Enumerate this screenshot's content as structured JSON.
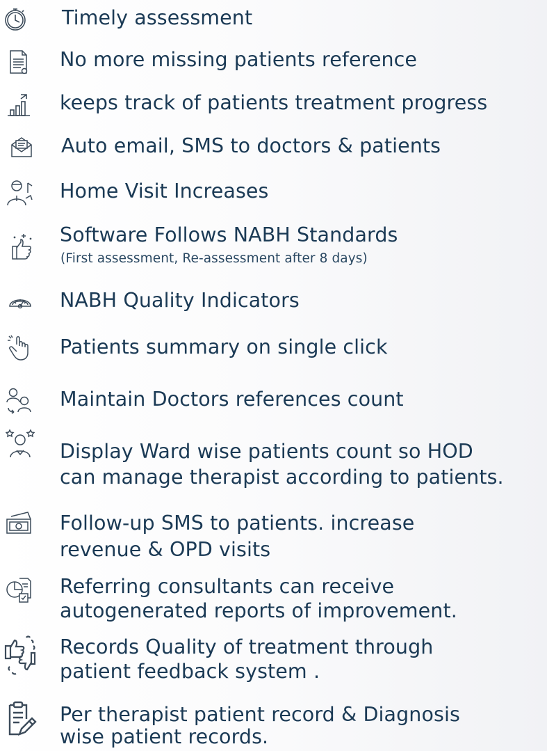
{
  "features": [
    {
      "icon": "stopwatch-icon",
      "line1": "Timely assessment",
      "line2": "",
      "sub": ""
    },
    {
      "icon": "document-icon",
      "line1": "No more missing patients reference",
      "line2": "",
      "sub": ""
    },
    {
      "icon": "bar-chart-growth-icon",
      "line1": "keeps track of patients treatment progress",
      "line2": "",
      "sub": ""
    },
    {
      "icon": "envelope-icon",
      "line1": "Auto email, SMS to doctors & patients",
      "line2": "",
      "sub": ""
    },
    {
      "icon": "home-visit-doctor-icon",
      "line1": "Home Visit Increases",
      "line2": "",
      "sub": ""
    },
    {
      "icon": "thumbs-up-sparkle-icon",
      "line1": "Software Follows NABH Standards",
      "line2": "",
      "sub": "(First assessment, Re-assessment after 8 days)"
    },
    {
      "icon": "gauge-icon",
      "line1": "NABH Quality Indicators",
      "line2": "",
      "sub": ""
    },
    {
      "icon": "hand-click-icon",
      "line1": "Patients summary on single click",
      "line2": "",
      "sub": ""
    },
    {
      "icon": "doctors-referral-icon",
      "line1": "Maintain Doctors references count",
      "line2": "",
      "sub": ""
    },
    {
      "icon": "staff-rating-icon",
      "line1": "Display Ward wise patients count so HOD",
      "line2": "can manage therapist according to patients.",
      "sub": ""
    },
    {
      "icon": "money-icon",
      "line1": "Follow-up SMS to patients. increase",
      "line2": "revenue & OPD visits",
      "sub": ""
    },
    {
      "icon": "report-analysis-icon",
      "line1": "Referring  consultants can receive",
      "line2": "autogenerated reports of improvement.",
      "sub": ""
    },
    {
      "icon": "feedback-thumbs-icon",
      "line1": "Records Quality of treatment through",
      "line2": "patient feedback system .",
      "sub": ""
    },
    {
      "icon": "clipboard-edit-icon",
      "line1": "Per therapist patient record & Diagnosis",
      "line2": "wise patient records.",
      "sub": ""
    }
  ],
  "colors": {
    "text": "#1b3a55",
    "icon_stroke": "#3c4b5a"
  }
}
